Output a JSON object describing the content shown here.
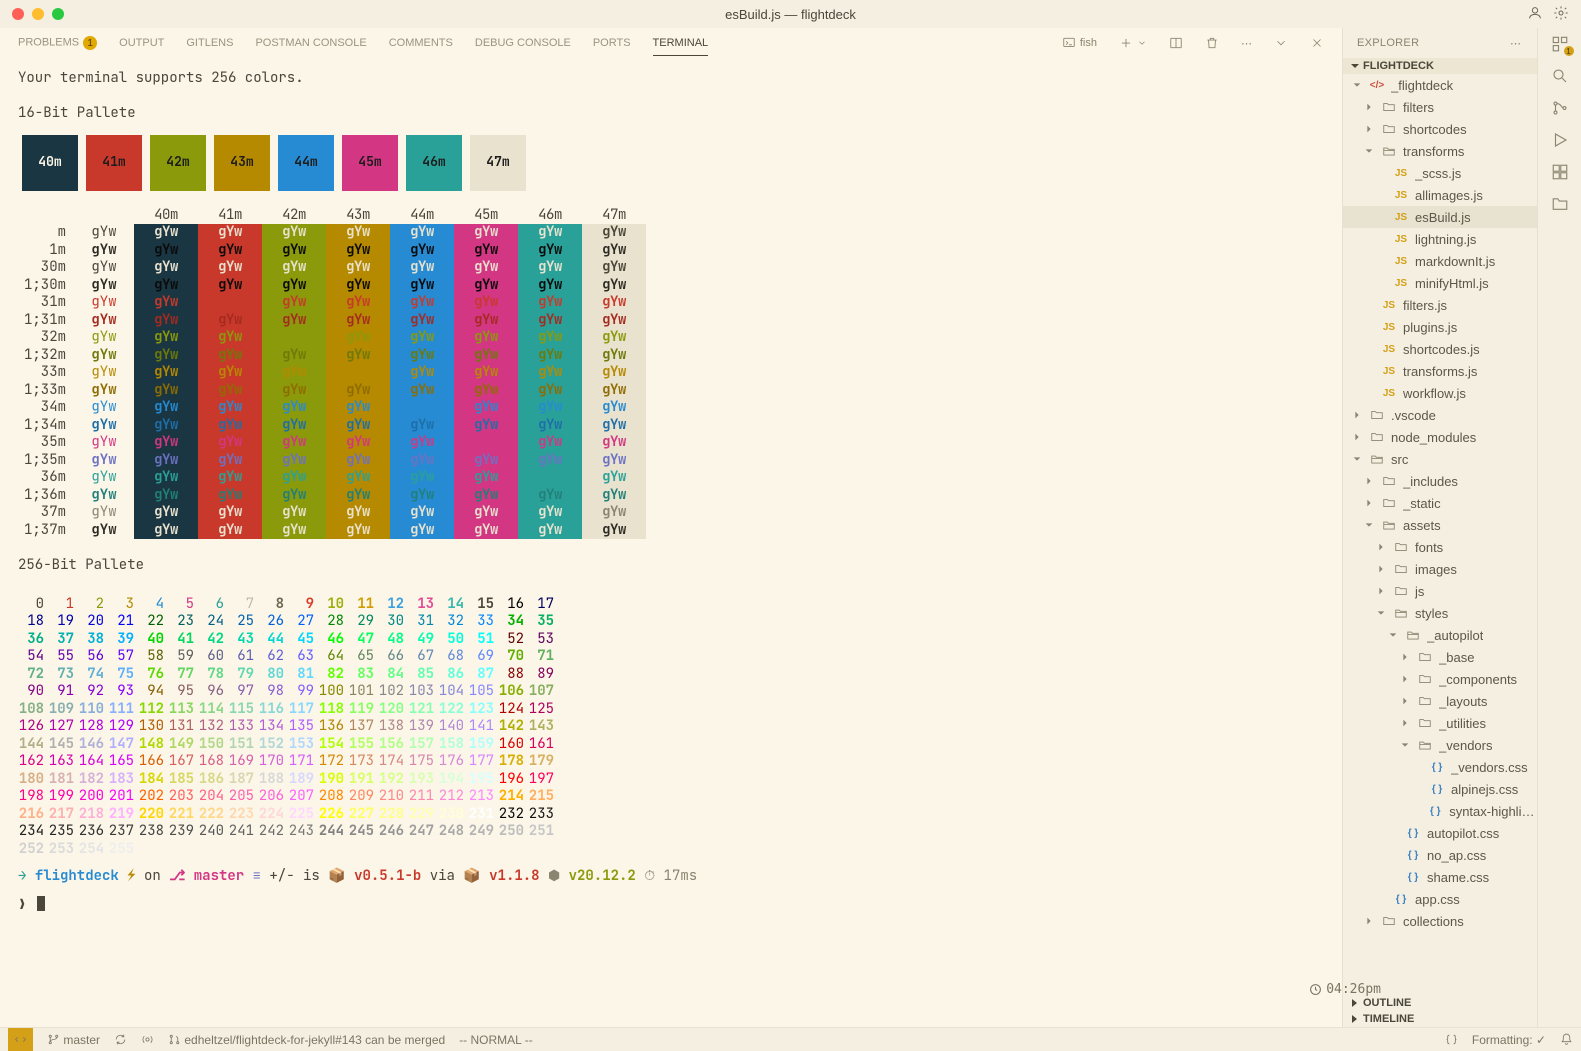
{
  "window_title": "esBuild.js — flightdeck",
  "panel_tabs": [
    "PROBLEMS",
    "OUTPUT",
    "GITLENS",
    "POSTMAN CONSOLE",
    "COMMENTS",
    "DEBUG CONSOLE",
    "PORTS",
    "TERMINAL"
  ],
  "problems_count": "1",
  "active_tab": "TERMINAL",
  "shell_name": "fish",
  "terminal": {
    "line1": "Your terminal supports 256 colors.",
    "h16": "16-Bit Pallete",
    "h256": "256-Bit Pallete",
    "swatches": [
      {
        "label": "40m",
        "bg": "#193642",
        "light": true
      },
      {
        "label": "41m",
        "bg": "#c9392b",
        "light": false
      },
      {
        "label": "42m",
        "bg": "#8a9a0b",
        "light": false
      },
      {
        "label": "43m",
        "bg": "#b58900",
        "light": false
      },
      {
        "label": "44m",
        "bg": "#268bd2",
        "light": false
      },
      {
        "label": "45m",
        "bg": "#d33682",
        "light": false
      },
      {
        "label": "46m",
        "bg": "#2aa198",
        "light": false
      },
      {
        "label": "47m",
        "bg": "#e9e2cf",
        "light": false
      }
    ],
    "bg_headers": [
      "40m",
      "41m",
      "42m",
      "43m",
      "44m",
      "45m",
      "46m",
      "47m"
    ],
    "bg_colors": [
      "#193642",
      "#c9392b",
      "#8a9a0b",
      "#b58900",
      "#268bd2",
      "#d33682",
      "#2aa198",
      "#e9e2cf"
    ],
    "rows16": [
      {
        "lab": "m",
        "plain": "#4a4639",
        "bold": false
      },
      {
        "lab": "1m",
        "plain": "#2c2a22",
        "bold": true
      },
      {
        "lab": "30m",
        "plain": "#4a4639",
        "bold": false
      },
      {
        "lab": "1;30m",
        "plain": "#2c2a22",
        "bold": true
      },
      {
        "lab": "31m",
        "plain": "#c9392b",
        "bold": false
      },
      {
        "lab": "1;31m",
        "plain": "#a52a1f",
        "bold": true
      },
      {
        "lab": "32m",
        "plain": "#8a9a0b",
        "bold": false
      },
      {
        "lab": "1;32m",
        "plain": "#6d7a08",
        "bold": true
      },
      {
        "lab": "33m",
        "plain": "#b58900",
        "bold": false
      },
      {
        "lab": "1;33m",
        "plain": "#8f6c00",
        "bold": true
      },
      {
        "lab": "34m",
        "plain": "#268bd2",
        "bold": false
      },
      {
        "lab": "1;34m",
        "plain": "#1e6ea8",
        "bold": true
      },
      {
        "lab": "35m",
        "plain": "#d33682",
        "bold": false
      },
      {
        "lab": "1;35m",
        "plain": "#6c71c4",
        "bold": true
      },
      {
        "lab": "36m",
        "plain": "#2aa198",
        "bold": false
      },
      {
        "lab": "1;36m",
        "plain": "#218079",
        "bold": true
      },
      {
        "lab": "37m",
        "plain": "#8a8470",
        "bold": false
      },
      {
        "lab": "1;37m",
        "plain": "#2c2a22",
        "bold": true
      }
    ],
    "sample": "gYw",
    "prompt": {
      "project": "flightdeck",
      "branch": "master",
      "dirty": "+/-",
      "is": "is",
      "pkg": "v0.5.1-b",
      "via": "via",
      "node_pkg": "v1.1.8",
      "node": "v20.12.2",
      "time": "17ms",
      "arrow": "→",
      "on": "on"
    },
    "clock": "04:26pm"
  },
  "explorer": {
    "title": "EXPLORER",
    "root": "FLIGHTDECK",
    "outline": "OUTLINE",
    "timeline": "TIMELINE",
    "tree": [
      {
        "d": 0,
        "t": "code",
        "n": "_flightdeck",
        "open": true
      },
      {
        "d": 1,
        "t": "fold",
        "n": "filters"
      },
      {
        "d": 1,
        "t": "fold",
        "n": "shortcodes"
      },
      {
        "d": 1,
        "t": "fold",
        "n": "transforms",
        "open": true
      },
      {
        "d": 2,
        "t": "js",
        "n": "_scss.js"
      },
      {
        "d": 2,
        "t": "js",
        "n": "allimages.js"
      },
      {
        "d": 2,
        "t": "js",
        "n": "esBuild.js",
        "sel": true
      },
      {
        "d": 2,
        "t": "js",
        "n": "lightning.js"
      },
      {
        "d": 2,
        "t": "js",
        "n": "markdownIt.js"
      },
      {
        "d": 2,
        "t": "js",
        "n": "minifyHtml.js"
      },
      {
        "d": 1,
        "t": "js",
        "n": "filters.js"
      },
      {
        "d": 1,
        "t": "js",
        "n": "plugins.js"
      },
      {
        "d": 1,
        "t": "js",
        "n": "shortcodes.js"
      },
      {
        "d": 1,
        "t": "js",
        "n": "transforms.js"
      },
      {
        "d": 1,
        "t": "js",
        "n": "workflow.js"
      },
      {
        "d": 0,
        "t": "foldsrc",
        "n": ".vscode"
      },
      {
        "d": 0,
        "t": "foldsrc",
        "n": "node_modules"
      },
      {
        "d": 0,
        "t": "foldsrc",
        "n": "src",
        "open": true
      },
      {
        "d": 1,
        "t": "fold",
        "n": "_includes"
      },
      {
        "d": 1,
        "t": "fold",
        "n": "_static"
      },
      {
        "d": 1,
        "t": "foldsrc",
        "n": "assets",
        "open": true
      },
      {
        "d": 2,
        "t": "fold",
        "n": "fonts"
      },
      {
        "d": 2,
        "t": "fold",
        "n": "images"
      },
      {
        "d": 2,
        "t": "foldsrc",
        "n": "js"
      },
      {
        "d": 2,
        "t": "foldsrc",
        "n": "styles",
        "open": true
      },
      {
        "d": 3,
        "t": "fold",
        "n": "_autopilot",
        "open": true
      },
      {
        "d": 4,
        "t": "fold",
        "n": "_base"
      },
      {
        "d": 4,
        "t": "fold",
        "n": "_components"
      },
      {
        "d": 4,
        "t": "fold",
        "n": "_layouts"
      },
      {
        "d": 4,
        "t": "fold",
        "n": "_utilities"
      },
      {
        "d": 4,
        "t": "fold",
        "n": "_vendors",
        "open": true
      },
      {
        "d": 5,
        "t": "css",
        "n": "_vendors.css"
      },
      {
        "d": 5,
        "t": "css",
        "n": "alpinejs.css"
      },
      {
        "d": 5,
        "t": "css",
        "n": "syntax-highlight…"
      },
      {
        "d": 3,
        "t": "css",
        "n": "autopilot.css"
      },
      {
        "d": 3,
        "t": "css",
        "n": "no_ap.css"
      },
      {
        "d": 3,
        "t": "css",
        "n": "shame.css"
      },
      {
        "d": 2,
        "t": "css",
        "n": "app.css"
      },
      {
        "d": 1,
        "t": "fold",
        "n": "collections"
      }
    ]
  },
  "status": {
    "branch": "master",
    "pr": "edheltzel/flightdeck-for-jekyll#143 can be merged",
    "mode": "-- NORMAL --",
    "formatting": "Formatting: ✓"
  }
}
